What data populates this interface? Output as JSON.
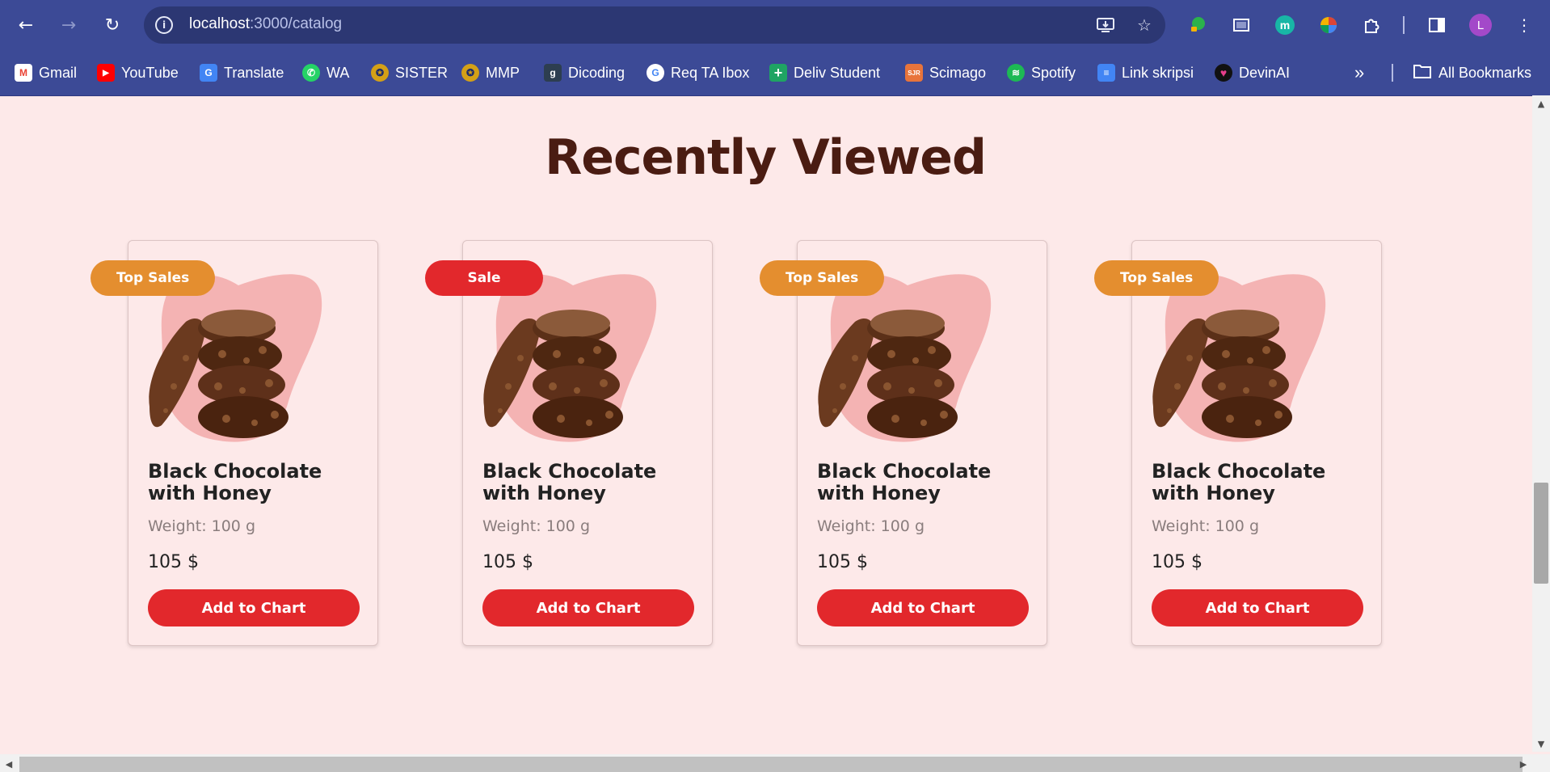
{
  "browser": {
    "url_host": "localhost",
    "url_path": ":3000/catalog",
    "avatar_initial": "L",
    "bookmarks": [
      {
        "label": "Gmail",
        "icon": "gmail-icon",
        "color": "#ea4335",
        "glyph": "M"
      },
      {
        "label": "YouTube",
        "icon": "youtube-icon",
        "color": "#ff0000",
        "glyph": "▶"
      },
      {
        "label": "Translate",
        "icon": "translate-icon",
        "color": "#4285f4",
        "glyph": "G"
      },
      {
        "label": "WA",
        "icon": "whatsapp-icon",
        "color": "#25d366",
        "glyph": "✆"
      },
      {
        "label": "SISTER",
        "icon": "sister-icon",
        "color": "#d4a017",
        "glyph": "✪"
      },
      {
        "label": "MMP",
        "icon": "mmp-icon",
        "color": "#d4a017",
        "glyph": "✪"
      },
      {
        "label": "Dicoding",
        "icon": "dicoding-icon",
        "color": "#2d3e50",
        "glyph": "g"
      },
      {
        "label": "Req TA Ibox",
        "icon": "google-icon",
        "color": "#ffffff",
        "glyph": "G"
      },
      {
        "label": "Deliv Student",
        "icon": "sheets-icon",
        "color": "#1fa463",
        "glyph": "+"
      },
      {
        "label": "Scimago",
        "icon": "scimago-icon",
        "color": "#e8743b",
        "glyph": "SJR"
      },
      {
        "label": "Spotify",
        "icon": "spotify-icon",
        "color": "#1db954",
        "glyph": "≋"
      },
      {
        "label": "Link skripsi",
        "icon": "docs-icon",
        "color": "#4285f4",
        "glyph": "≡"
      },
      {
        "label": "DevinAI",
        "icon": "devin-icon",
        "color": "#e83e8c",
        "glyph": "♥"
      }
    ],
    "all_bookmarks_label": "All Bookmarks"
  },
  "section": {
    "title": "Recently Viewed"
  },
  "products": [
    {
      "badge": "Top Sales",
      "badge_color": "orange",
      "name": "Black Chocolate with Honey",
      "weight": "Weight: 100 g",
      "price": "105 $",
      "button": "Add to Chart"
    },
    {
      "badge": "Sale",
      "badge_color": "red",
      "name": "Black Chocolate with Honey",
      "weight": "Weight: 100 g",
      "price": "105 $",
      "button": "Add to Chart"
    },
    {
      "badge": "Top Sales",
      "badge_color": "orange",
      "name": "Black Chocolate with Honey",
      "weight": "Weight: 100 g",
      "price": "105 $",
      "button": "Add to Chart"
    },
    {
      "badge": "Top Sales",
      "badge_color": "orange",
      "name": "Black Chocolate with Honey",
      "weight": "Weight: 100 g",
      "price": "105 $",
      "button": "Add to Chart"
    }
  ],
  "colors": {
    "page_bg": "#fde9e9",
    "heading": "#4a1c12",
    "accent_red": "#e2282c",
    "accent_orange": "#e48e2f",
    "blob": "#f4b3b3",
    "chrome": "#3c4a96"
  }
}
